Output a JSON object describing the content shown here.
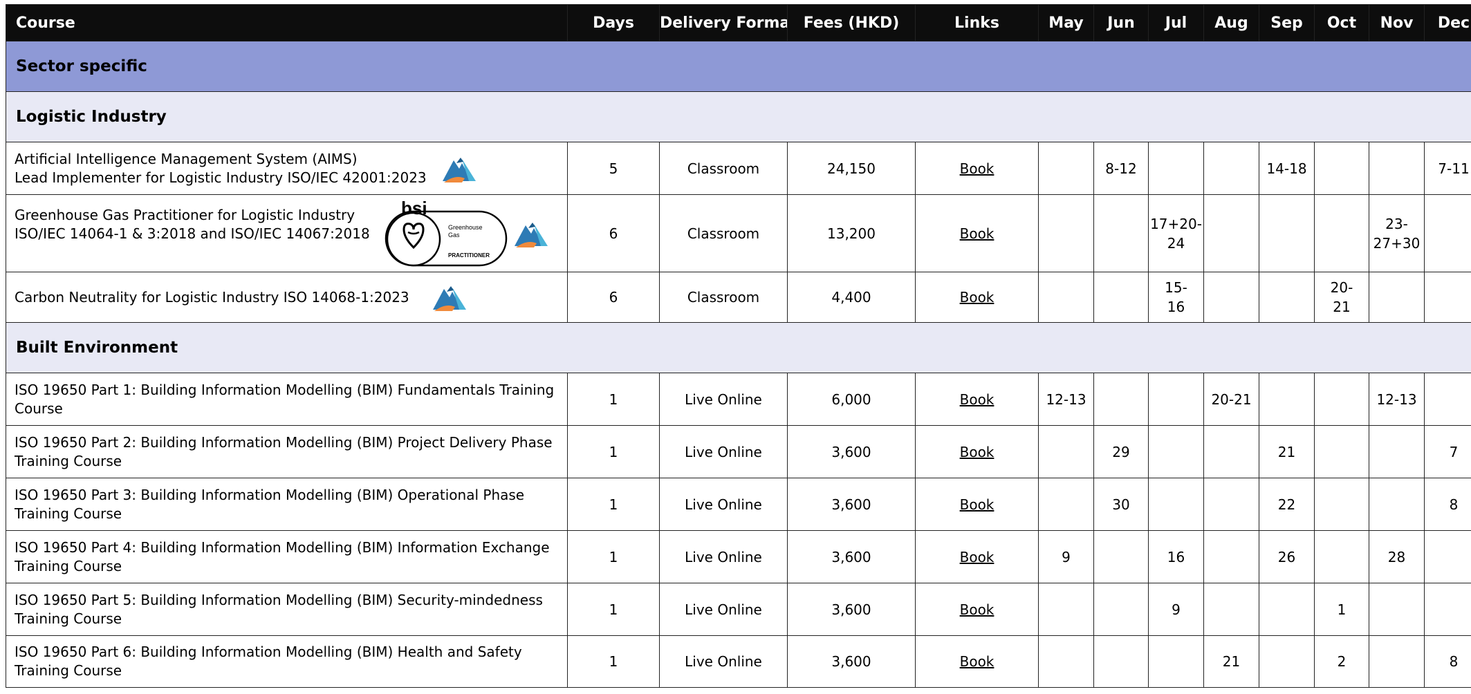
{
  "headers": {
    "course": "Course",
    "days": "Days",
    "delivery": "Delivery Format",
    "fees": "Fees (HKD)",
    "links": "Links",
    "months": [
      "May",
      "Jun",
      "Jul",
      "Aug",
      "Sep",
      "Oct",
      "Nov",
      "Dec"
    ]
  },
  "sector": "Sector specific",
  "logistic": {
    "title": "Logistic Industry",
    "rows": [
      {
        "line1": "Artificial Intelligence Management System (AIMS)",
        "line2": "Lead Implementer for Logistic Industry ISO/IEC 42001:2023",
        "days": "5",
        "format": "Classroom",
        "fees": "24,150",
        "link": "Book",
        "may": "",
        "jun": "8-12",
        "jul": "",
        "aug": "",
        "sep": "14-18",
        "oct": "",
        "nov": "",
        "dec": "7-11"
      },
      {
        "line1": "Greenhouse Gas Practitioner for Logistic Industry",
        "line2": "ISO/IEC 14064-1 & 3:2018 and ISO/IEC 14067:2018",
        "days": "6",
        "format": "Classroom",
        "fees": "13,200",
        "link": "Book",
        "may": "",
        "jun": "",
        "jul_a": "17+20-",
        "jul_b": "24",
        "aug": "",
        "sep": "",
        "oct": "",
        "nov_a": "23-",
        "nov_b": "27+30",
        "dec": ""
      },
      {
        "line1": "Carbon Neutrality for Logistic Industry ISO 14068-1:2023",
        "days": "6",
        "format": "Classroom",
        "fees": "4,400",
        "link": "Book",
        "may": "",
        "jun": "",
        "jul_a": "15-",
        "jul_b": "16",
        "aug": "",
        "sep": "",
        "oct_a": "20-",
        "oct_b": "21",
        "nov": "",
        "dec": ""
      }
    ],
    "bsi_logo": {
      "brand": "bsi",
      "line1": "Greenhouse",
      "line2": "Gas",
      "line3": "PRACTITIONER"
    }
  },
  "built": {
    "title": "Built Environment",
    "rows": [
      {
        "line1": "ISO 19650 Part 1: Building Information Modelling (BIM) Fundamentals Training",
        "line2": "Course",
        "days": "1",
        "format": "Live Online",
        "fees": "6,000",
        "link": "Book",
        "may": "12-13",
        "jun": "",
        "jul": "",
        "aug": "20-21",
        "sep": "",
        "oct": "",
        "nov": "12-13",
        "dec": ""
      },
      {
        "line1": "ISO 19650 Part 2: Building Information Modelling (BIM) Project Delivery Phase",
        "line2": "Training Course",
        "days": "1",
        "format": "Live Online",
        "fees": "3,600",
        "link": "Book",
        "may": "",
        "jun": "29",
        "jul": "",
        "aug": "",
        "sep": "21",
        "oct": "",
        "nov": "",
        "dec": "7"
      },
      {
        "line1": "ISO 19650 Part 3: Building Information Modelling (BIM) Operational Phase",
        "line2": "Training Course",
        "days": "1",
        "format": "Live Online",
        "fees": "3,600",
        "link": "Book",
        "may": "",
        "jun": "30",
        "jul": "",
        "aug": "",
        "sep": "22",
        "oct": "",
        "nov": "",
        "dec": "8"
      },
      {
        "line1": "ISO 19650 Part 4: Building Information Modelling (BIM) Information Exchange",
        "line2": "Training Course",
        "days": "1",
        "format": "Live Online",
        "fees": "3,600",
        "link": "Book",
        "may": "9",
        "jun": "",
        "jul": "16",
        "aug": "",
        "sep": "26",
        "oct": "",
        "nov": "28",
        "dec": ""
      },
      {
        "line1": "ISO 19650 Part 5: Building Information Modelling (BIM) Security-mindedness",
        "line2": "Training Course",
        "days": "1",
        "format": "Live Online",
        "fees": "3,600",
        "link": "Book",
        "may": "",
        "jun": "",
        "jul": "9",
        "aug": "",
        "sep": "",
        "oct": "1",
        "nov": "",
        "dec": ""
      },
      {
        "line1": "ISO 19650 Part 6: Building Information Modelling (BIM) Health and Safety",
        "line2": "Training Course",
        "days": "1",
        "format": "Live Online",
        "fees": "3,600",
        "link": "Book",
        "may": "",
        "jun": "",
        "jul": "",
        "aug": "21",
        "sep": "",
        "oct": "2",
        "nov": "",
        "dec": "8"
      }
    ]
  }
}
